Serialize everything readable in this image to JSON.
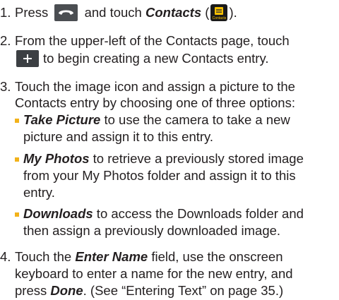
{
  "steps": [
    {
      "number": "1.",
      "text_a": "Press",
      "text_b": "and touch",
      "contacts_label": "Contacts",
      "paren_open": "(",
      "paren_close": ")."
    },
    {
      "number": "2.",
      "line1": "From the upper-left of the Contacts page, touch",
      "line2": "to begin creating a new Contacts entry."
    },
    {
      "number": "3.",
      "line1": "Touch the image icon and assign a picture to the",
      "line2": "Contacts entry by choosing one of three options:"
    },
    {
      "number": "4.",
      "line1_a": "Touch the",
      "line1_b": "Enter Name",
      "line1_c": "field, use the onscreen",
      "line2": "keyboard to enter a name for the new entry, and",
      "line3_a": "press",
      "line3_b": "Done",
      "line3_c": ". (See “Entering Text” on page 35.)"
    }
  ],
  "options": [
    {
      "term": "Take Picture",
      "line1": " to use the camera to take a new",
      "line2": "picture and assign it to this entry."
    },
    {
      "term": "My Photos",
      "line1": " to retrieve a previously stored image",
      "line2": "from your My Photos folder and assign it to this",
      "line3": "entry."
    },
    {
      "term": "Downloads",
      "line1": " to access the Downloads folder and",
      "line2": "then assign a previously downloaded image."
    }
  ],
  "icons": {
    "phone": "phone-icon",
    "contacts": "contacts-icon",
    "contacts_icon_text": "Contacts",
    "plus": "plus-icon"
  },
  "colors": {
    "text": "#231f20",
    "bullet": "#f2b21a",
    "icon_bg": "#3c3f43",
    "contacts_yellow": "#f6c000"
  }
}
